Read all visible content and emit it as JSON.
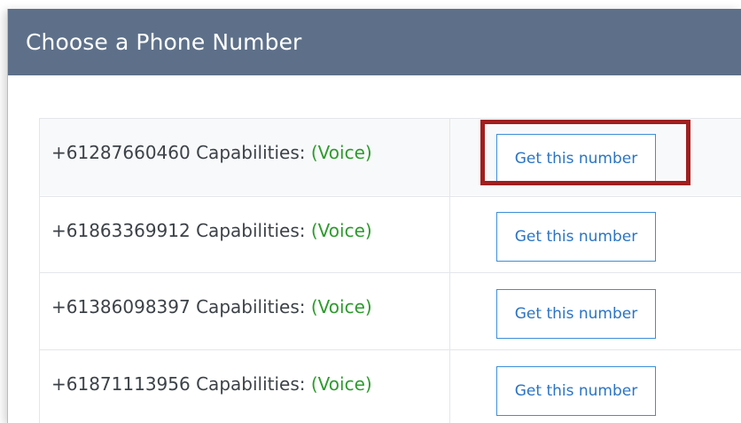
{
  "dialog": {
    "title": "Choose a Phone Number"
  },
  "numbers": [
    {
      "phone": "+61287660460",
      "capabilities_label": "Capabilities:",
      "capability": "(Voice)",
      "button_label": "Get this number"
    },
    {
      "phone": "+61863369912",
      "capabilities_label": "Capabilities:",
      "capability": "(Voice)",
      "button_label": "Get this number"
    },
    {
      "phone": "+61386098397",
      "capabilities_label": "Capabilities:",
      "capability": "(Voice)",
      "button_label": "Get this number"
    },
    {
      "phone": "+61871113956",
      "capabilities_label": "Capabilities:",
      "capability": "(Voice)",
      "button_label": "Get this number"
    }
  ],
  "colors": {
    "header_bg": "#5e7089",
    "capability_green": "#2e9b2e",
    "button_blue": "#2a74c4",
    "highlight_red": "#a11e1e"
  }
}
